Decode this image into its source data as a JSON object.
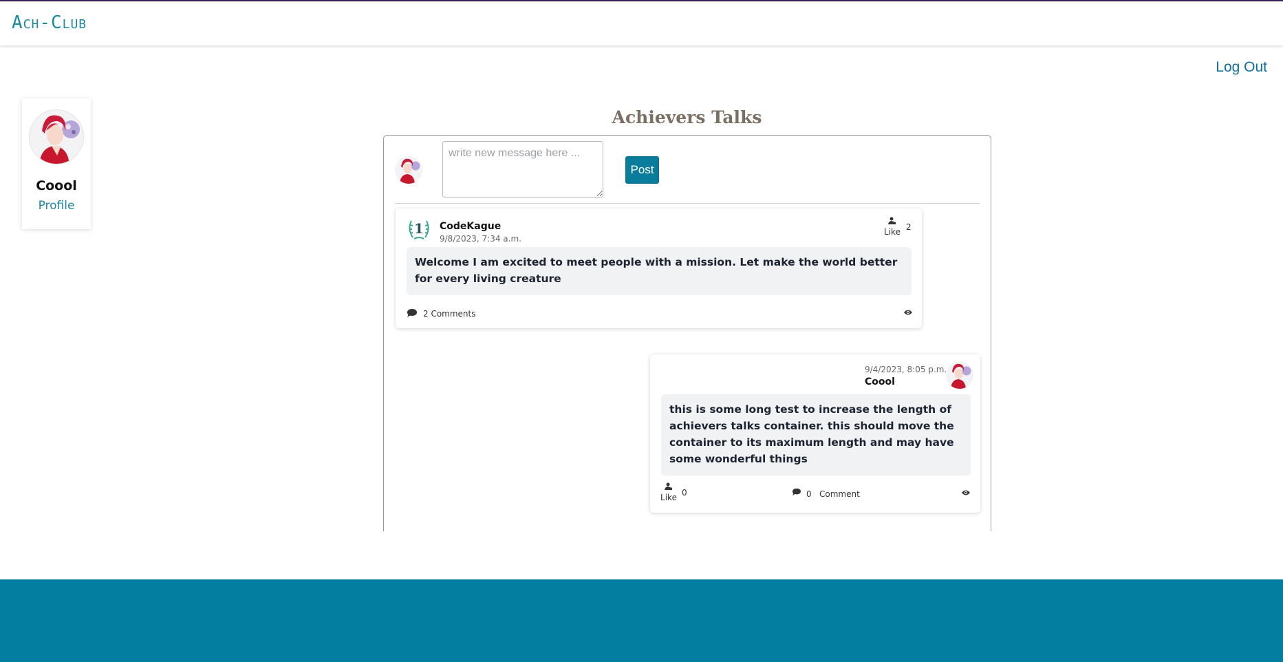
{
  "app": {
    "brand": "Ach-Club",
    "logout_label": "Log Out"
  },
  "profile": {
    "name": "Coool",
    "link_label": "Profile"
  },
  "page": {
    "title": "Achievers Talks"
  },
  "composer": {
    "placeholder": "write new message here ...",
    "post_label": "Post"
  },
  "posts": [
    {
      "author": "CodeKague",
      "date": "9/8/2023, 7:34 a.m.",
      "badge": "1",
      "body": "Welcome I am excited to meet people with a mission. Let make the world better for every living creature",
      "like_label": "Like",
      "likes": "2",
      "comments_label": "2 Comments"
    },
    {
      "author": "Coool",
      "date": "9/4/2023, 8:05 p.m.",
      "body": "this is some long test to increase the length of achievers talks container. this should move the container to its maximum length and may have some wonderful things",
      "like_label": "Like",
      "likes": "0",
      "comments_count": "0",
      "comments_label": "Comment"
    }
  ],
  "colors": {
    "brand": "#1b8aa5",
    "footer": "#037ea0",
    "post_button": "#0b7d9c",
    "topline": "#3b1f5c"
  },
  "icons": [
    "user-avatar-icon",
    "badge-laurel-icon",
    "like-hand-icon",
    "comment-bubble-icon",
    "eye-icon"
  ]
}
